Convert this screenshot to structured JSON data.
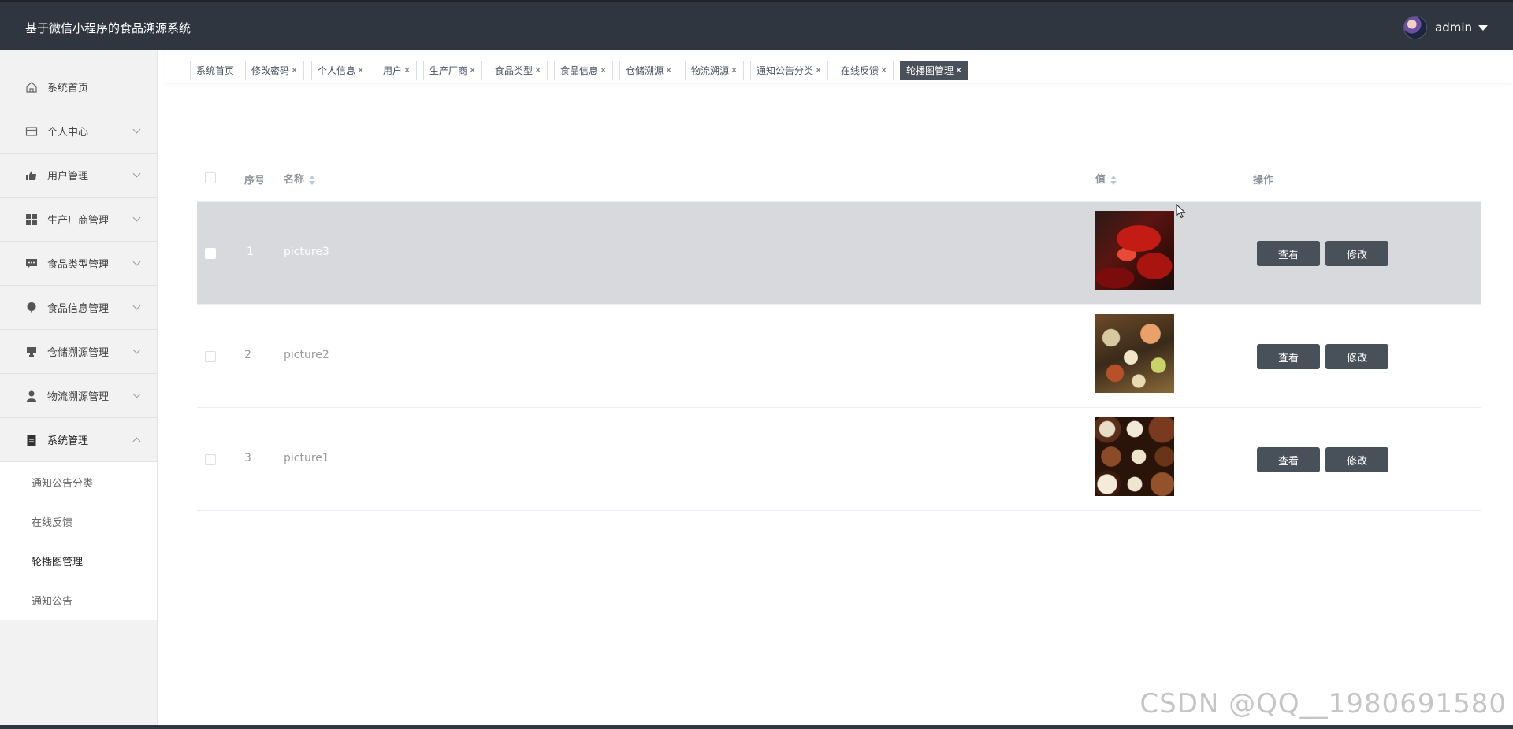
{
  "header": {
    "title": "基于微信小程序的食品溯源系统",
    "username": "admin"
  },
  "sidebar": {
    "items": [
      {
        "label": "系统首页",
        "icon": "home-icon"
      },
      {
        "label": "个人中心",
        "icon": "card-icon"
      },
      {
        "label": "用户管理",
        "icon": "thumb-icon"
      },
      {
        "label": "生产厂商管理",
        "icon": "grid-icon"
      },
      {
        "label": "食品类型管理",
        "icon": "chat-icon"
      },
      {
        "label": "食品信息管理",
        "icon": "balloon-icon"
      },
      {
        "label": "仓储溯源管理",
        "icon": "stamp-icon"
      },
      {
        "label": "物流溯源管理",
        "icon": "user-icon"
      },
      {
        "label": "系统管理",
        "icon": "clipboard-icon"
      }
    ],
    "submenu": [
      "通知公告分类",
      "在线反馈",
      "轮播图管理",
      "通知公告"
    ]
  },
  "tabs": [
    "系统首页",
    "修改密码",
    "个人信息",
    "用户",
    "生产厂商",
    "食品类型",
    "食品信息",
    "仓储溯源",
    "物流溯源",
    "通知公告分类",
    "在线反馈",
    "轮播图管理"
  ],
  "table": {
    "headers": {
      "index": "序号",
      "name": "名称",
      "value": "值",
      "action": "操作"
    },
    "rows": [
      {
        "index": "1",
        "name": "picture3",
        "image": "lobster"
      },
      {
        "index": "2",
        "name": "picture2",
        "image": "sushi"
      },
      {
        "index": "3",
        "name": "picture1",
        "image": "chocolates"
      }
    ],
    "view_label": "查看",
    "edit_label": "修改"
  },
  "watermark": "CSDN @QQ__1980691580",
  "colors": {
    "header_bg": "#2f3640",
    "button_bg": "#48505a",
    "hover_row": "#d7d9dc"
  }
}
